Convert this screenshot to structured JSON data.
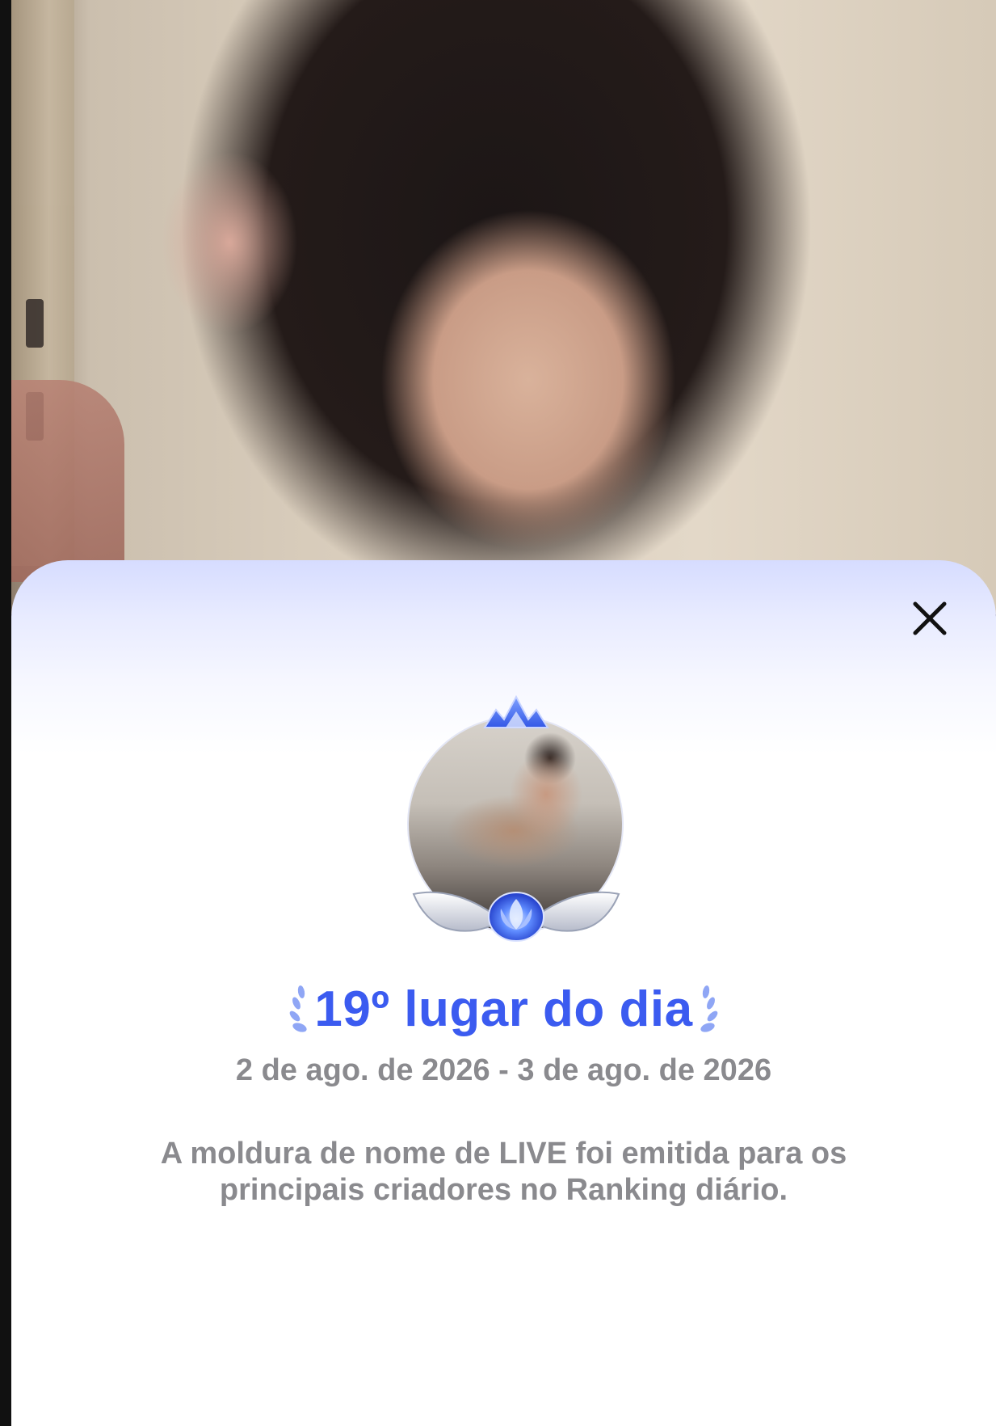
{
  "sheet": {
    "close_icon": "close-icon",
    "badge_icons": [
      "crown-icon",
      "wings-icon",
      "lotus-flame-icon"
    ],
    "rank_title": "19º lugar do dia",
    "date_range": "2 de ago. de 2026 - 3 de ago. de 2026",
    "description": "A moldura de nome de LIVE foi emitida para os principais criadores no Ranking diário.",
    "accent_color": "#3b5bf0",
    "text_muted_color": "#8a8a8e"
  }
}
